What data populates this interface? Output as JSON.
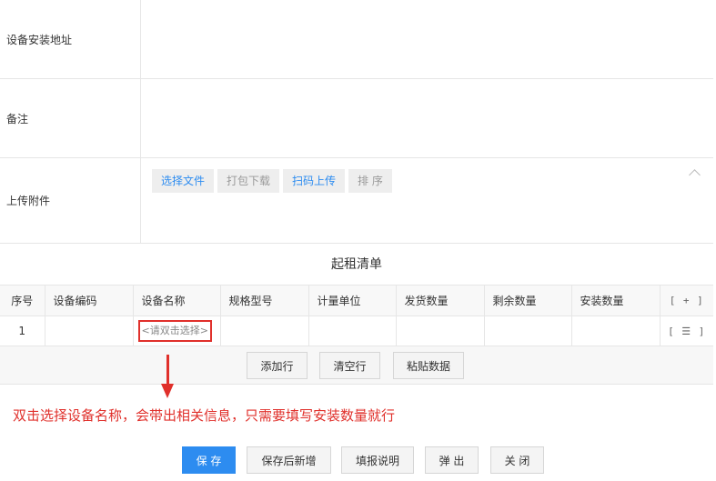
{
  "form": {
    "address_label": "设备安装地址",
    "remark_label": "备注",
    "upload_label": "上传附件",
    "upload_buttons": {
      "select_file": "选择文件",
      "pack_download": "打包下载",
      "scan_upload": "扫码上传",
      "sort": "排 序"
    }
  },
  "list": {
    "title": "起租清单",
    "columns": [
      "序号",
      "设备编码",
      "设备名称",
      "规格型号",
      "计量单位",
      "发货数量",
      "剩余数量",
      "安装数量"
    ],
    "add_column_button": "[ + ]",
    "rows": [
      {
        "seq": "1",
        "code": "",
        "name_placeholder": "<请双击选择>",
        "spec": "",
        "unit": "",
        "shipped": "",
        "remaining": "",
        "installed": "",
        "menu_button": "[ ☰ ]"
      }
    ],
    "row_actions": {
      "add_row": "添加行",
      "clear_empty_rows": "清空行",
      "paste_data": "粘贴数据"
    }
  },
  "annotation": "双击选择设备名称，会带出相关信息，只需要填写安装数量就行",
  "footer": {
    "save": "保 存",
    "save_and_new": "保存后新增",
    "fill_instructions": "填报说明",
    "popup": "弹 出",
    "close": "关 闭"
  },
  "colors": {
    "primary": "#2d8cf0",
    "annotation_red": "#e0302b",
    "border": "#e6e6e6"
  }
}
